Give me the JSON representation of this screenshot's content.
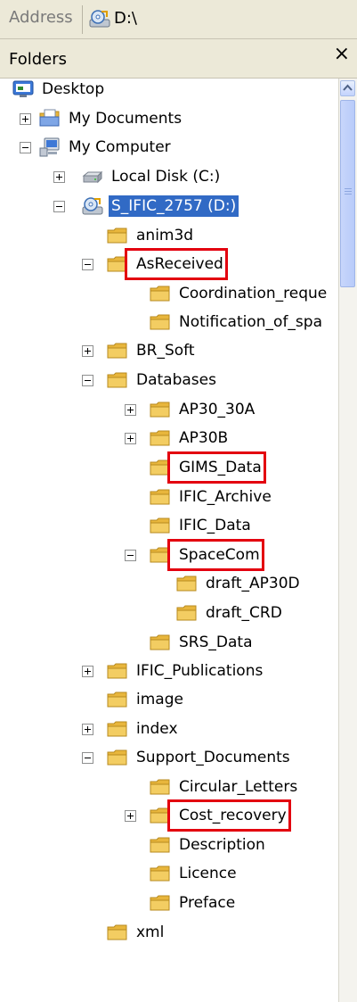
{
  "address": {
    "label": "Address",
    "value": "D:\\"
  },
  "folders": {
    "title": "Folders",
    "close_glyph": "×"
  },
  "tree": {
    "rows": [
      {
        "label": "Desktop",
        "icon": "desktop-icon"
      },
      {
        "label": "My Documents",
        "icon": "my-documents-icon",
        "expander": "plus"
      },
      {
        "label": "My Computer",
        "icon": "my-computer-icon",
        "expander": "minus"
      },
      {
        "label": "Local Disk (C:)",
        "icon": "hard-drive-icon",
        "expander": "plus"
      },
      {
        "label": "S_IFIC_2757 (D:)",
        "icon": "cd-drive-icon",
        "expander": "minus",
        "selected": true
      },
      {
        "label": "anim3d",
        "icon": "folder-icon"
      },
      {
        "label": "AsReceived",
        "icon": "folder-icon",
        "expander": "minus",
        "highlighted": true
      },
      {
        "label": "Coordination_reque",
        "icon": "folder-icon"
      },
      {
        "label": "Notification_of_spa",
        "icon": "folder-icon"
      },
      {
        "label": "BR_Soft",
        "icon": "folder-icon",
        "expander": "plus"
      },
      {
        "label": "Databases",
        "icon": "folder-icon",
        "expander": "minus"
      },
      {
        "label": "AP30_30A",
        "icon": "folder-icon",
        "expander": "plus"
      },
      {
        "label": "AP30B",
        "icon": "folder-icon",
        "expander": "plus"
      },
      {
        "label": "GIMS_Data",
        "icon": "folder-icon",
        "highlighted": true
      },
      {
        "label": "IFIC_Archive",
        "icon": "folder-icon"
      },
      {
        "label": "IFIC_Data",
        "icon": "folder-icon"
      },
      {
        "label": "SpaceCom",
        "icon": "folder-icon",
        "expander": "minus",
        "highlighted": true
      },
      {
        "label": "draft_AP30D",
        "icon": "folder-icon"
      },
      {
        "label": "draft_CRD",
        "icon": "folder-icon"
      },
      {
        "label": "SRS_Data",
        "icon": "folder-icon"
      },
      {
        "label": "IFIC_Publications",
        "icon": "folder-icon",
        "expander": "plus"
      },
      {
        "label": "image",
        "icon": "folder-icon"
      },
      {
        "label": "index",
        "icon": "folder-icon",
        "expander": "plus"
      },
      {
        "label": "Support_Documents",
        "icon": "folder-icon",
        "expander": "minus"
      },
      {
        "label": "Circular_Letters",
        "icon": "folder-icon"
      },
      {
        "label": "Cost_recovery",
        "icon": "folder-icon",
        "expander": "plus",
        "highlighted": true
      },
      {
        "label": "Description",
        "icon": "folder-icon"
      },
      {
        "label": "Licence",
        "icon": "folder-icon"
      },
      {
        "label": "Preface",
        "icon": "folder-icon"
      },
      {
        "label": "xml",
        "icon": "folder-icon"
      }
    ]
  },
  "colors": {
    "highlight_border": "#e3000f",
    "selection": "#316ac5",
    "folder": "#f3cd62"
  }
}
